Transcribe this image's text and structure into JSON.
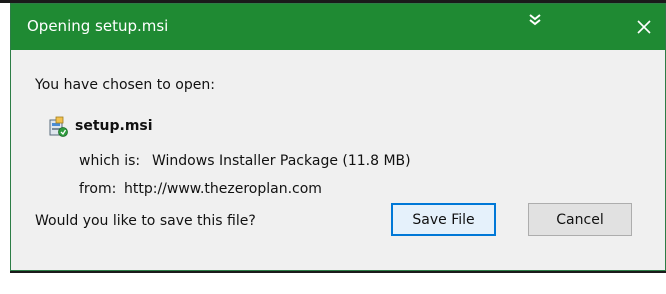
{
  "window": {
    "title": "Opening setup.msi",
    "collapse_icon": "double-chevron-down-icon",
    "close_icon": "close-icon",
    "title_bar_color": "#1f8a33"
  },
  "content": {
    "intro": "You have chosen to open:",
    "file": {
      "icon": "msi-installer-icon",
      "name": "setup.msi",
      "which_is_label": "which is:",
      "which_is_value": "Windows Installer Package (11.8 MB)",
      "from_label": "from:",
      "from_value": "http://www.thezeroplan.com"
    },
    "question": "Would you like to save this file?"
  },
  "buttons": {
    "save": "Save File",
    "cancel": "Cancel"
  }
}
